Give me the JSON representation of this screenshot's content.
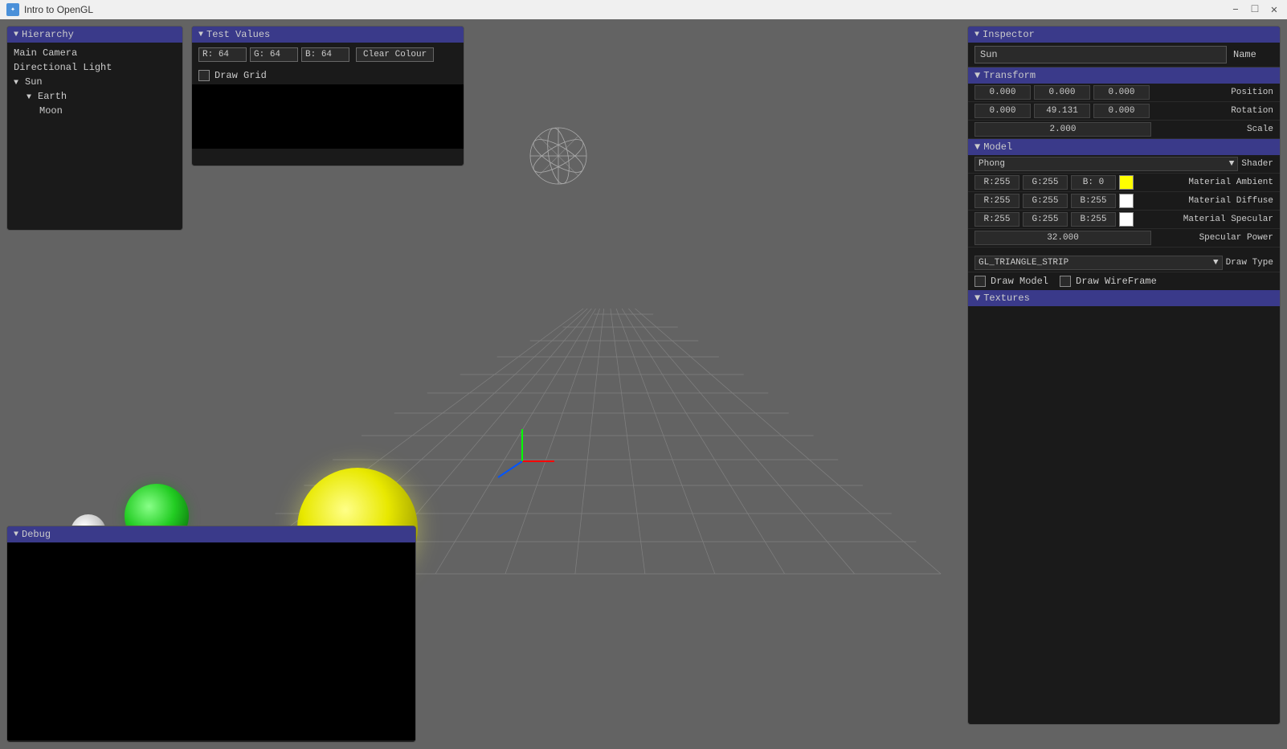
{
  "titleBar": {
    "title": "Intro to OpenGL",
    "minimizeLabel": "–",
    "maximizeLabel": "□",
    "closeLabel": "✕"
  },
  "hierarchy": {
    "panelTitle": "Hierarchy",
    "items": [
      {
        "label": "Main Camera",
        "indent": 0,
        "hasArrow": false
      },
      {
        "label": "Directional Light",
        "indent": 0,
        "hasArrow": false
      },
      {
        "label": "Sun",
        "indent": 0,
        "hasArrow": true,
        "expanded": true
      },
      {
        "label": "Earth",
        "indent": 1,
        "hasArrow": true,
        "expanded": true
      },
      {
        "label": "Moon",
        "indent": 2,
        "hasArrow": false
      }
    ]
  },
  "testValues": {
    "panelTitle": "Test Values",
    "r": {
      "label": "R:",
      "value": "64"
    },
    "g": {
      "label": "G:",
      "value": "64"
    },
    "b": {
      "label": "B:",
      "value": "64"
    },
    "clearColourBtn": "Clear Colour",
    "drawGridLabel": "Draw Grid",
    "drawGridChecked": false
  },
  "inspector": {
    "panelTitle": "Inspector",
    "nameValue": "Sun",
    "nameLabel": "Name",
    "transformSection": "Transform",
    "position": {
      "label": "Position",
      "x": "0.000",
      "y": "0.000",
      "z": "0.000"
    },
    "rotation": {
      "label": "Rotation",
      "x": "0.000",
      "y": "49.131",
      "z": "0.000"
    },
    "scale": {
      "label": "Scale",
      "value": "2.000"
    },
    "modelSection": "Model",
    "shaderLabel": "Shader",
    "shaderValue": "Phong",
    "materialAmbientLabel": "Material Ambient",
    "materialAmbientR": "R:255",
    "materialAmbientG": "G:255",
    "materialAmbientB": "B:  0",
    "materialAmbientColor": "#ffff00",
    "materialDiffuseLabel": "Material Diffuse",
    "materialDiffuseR": "R:255",
    "materialDiffuseG": "G:255",
    "materialDiffuseB": "B:255",
    "materialDiffuseColor": "#ffffff",
    "materialSpecularLabel": "Material Specular",
    "materialSpecularR": "R:255",
    "materialSpecularG": "G:255",
    "materialSpecularB": "B:255",
    "materialSpecularColor": "#ffffff",
    "specularPowerLabel": "Specular Power",
    "specularPowerValue": "32.000",
    "drawTypeLabel": "Draw Type",
    "drawTypeValue": "GL_TRIANGLE_STRIP",
    "drawModelLabel": "Draw Model",
    "drawModelChecked": false,
    "drawWireframeLabel": "Draw WireFrame",
    "drawWireframeChecked": false,
    "texturesSection": "Textures"
  },
  "debug": {
    "panelTitle": "Debug"
  },
  "viewport": {
    "background": "#636363"
  }
}
